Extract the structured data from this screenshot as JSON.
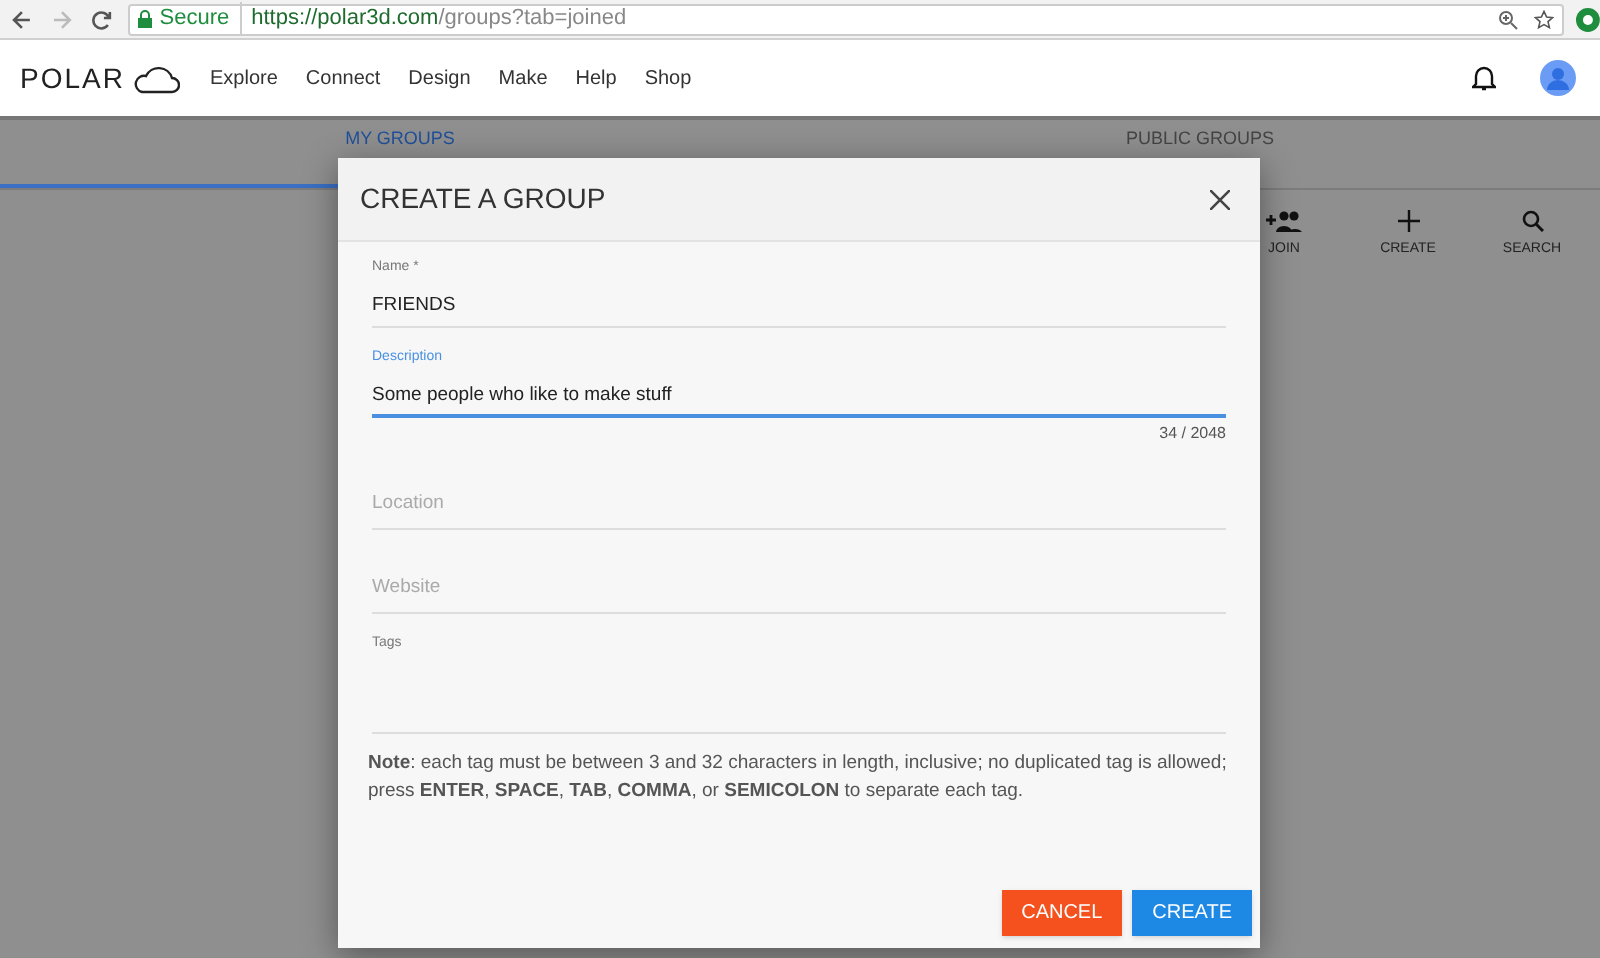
{
  "browser": {
    "secure_label": "Secure",
    "url_host": "https://polar3d.com",
    "url_path": "/groups?tab=joined"
  },
  "nav": {
    "logo": "POLAR",
    "links": [
      "Explore",
      "Connect",
      "Design",
      "Make",
      "Help",
      "Shop"
    ]
  },
  "tabs": [
    {
      "label": "MY GROUPS",
      "selected": true
    },
    {
      "label": "PUBLIC GROUPS",
      "selected": false
    }
  ],
  "actions": [
    {
      "label": "JOIN",
      "kind": "join"
    },
    {
      "label": "CREATE",
      "kind": "create"
    },
    {
      "label": "SEARCH",
      "kind": "search"
    }
  ],
  "dialog": {
    "title": "CREATE A GROUP",
    "fields": [
      {
        "kind": "text",
        "label": "Name *",
        "value": "FRIENDS",
        "focused": false
      },
      {
        "kind": "text",
        "label": "Description",
        "value": "Some people who like to make stuff",
        "counter": "34 / 2048",
        "focused": true
      },
      {
        "kind": "text",
        "placeholder": "Location",
        "focused": false
      },
      {
        "kind": "text",
        "placeholder": "Website",
        "focused": false
      },
      {
        "kind": "tags",
        "label": "Tags",
        "focused": false
      }
    ],
    "note": "**Note**: each tag must be between 3 and 32 characters in length, inclusive; no duplicated tag is allowed; press **ENTER**, **SPACE**, **TAB**, **COMMA**, or **SEMICOLON** to separate each tag.",
    "buttons": [
      {
        "label": "CANCEL",
        "kind": "cancel"
      },
      {
        "label": "CREATE",
        "kind": "primary"
      }
    ]
  }
}
